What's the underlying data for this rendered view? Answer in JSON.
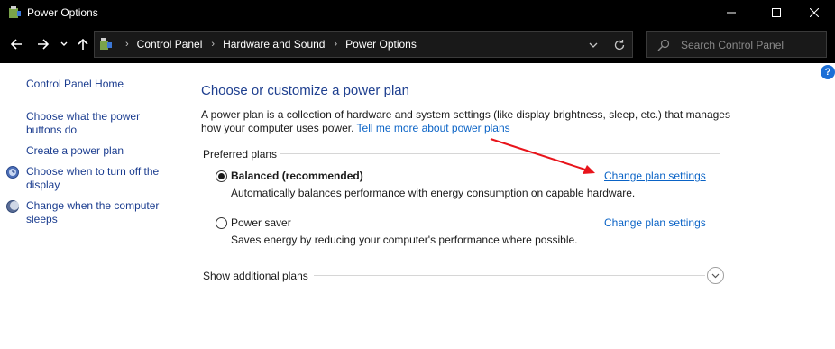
{
  "window": {
    "title": "Power Options",
    "minimize_icon": "minimize-icon",
    "maximize_icon": "maximize-icon",
    "close_icon": "close-icon"
  },
  "navigation": {
    "back_icon": "arrow-left-icon",
    "forward_icon": "arrow-right-icon",
    "recent_icon": "chevron-down-icon",
    "up_icon": "arrow-up-icon"
  },
  "address": {
    "crumbs": [
      "Control Panel",
      "Hardware and Sound",
      "Power Options"
    ],
    "refresh_icon": "refresh-icon"
  },
  "search": {
    "placeholder": "Search Control Panel"
  },
  "left_pane": {
    "home": "Control Panel Home",
    "require_password": "Choose what the power buttons do",
    "create_plan": "Create a power plan",
    "display_off": "Choose when to turn off the display",
    "sleep": "Change when the computer sleeps"
  },
  "main": {
    "title": "Choose or customize a power plan",
    "description": "A power plan is a collection of hardware and system settings (like display brightness, sleep, etc.) that manages how your computer uses power.",
    "learn_more": "Tell me more about power plans",
    "preferred_label": "Preferred plans",
    "plans": [
      {
        "name": "Balanced (recommended)",
        "description": "Automatically balances performance with energy consumption on capable hardware.",
        "link": "Change plan settings",
        "selected": true
      },
      {
        "name": "Power saver",
        "description": "Saves energy by reducing your computer's performance where possible.",
        "link": "Change plan settings",
        "selected": false
      }
    ],
    "additional_label": "Show additional plans"
  },
  "colors": {
    "titlebar": "#000000",
    "link": "#0a63c6",
    "heading": "#1e3f8f",
    "annotation_arrow": "#e8141b"
  }
}
